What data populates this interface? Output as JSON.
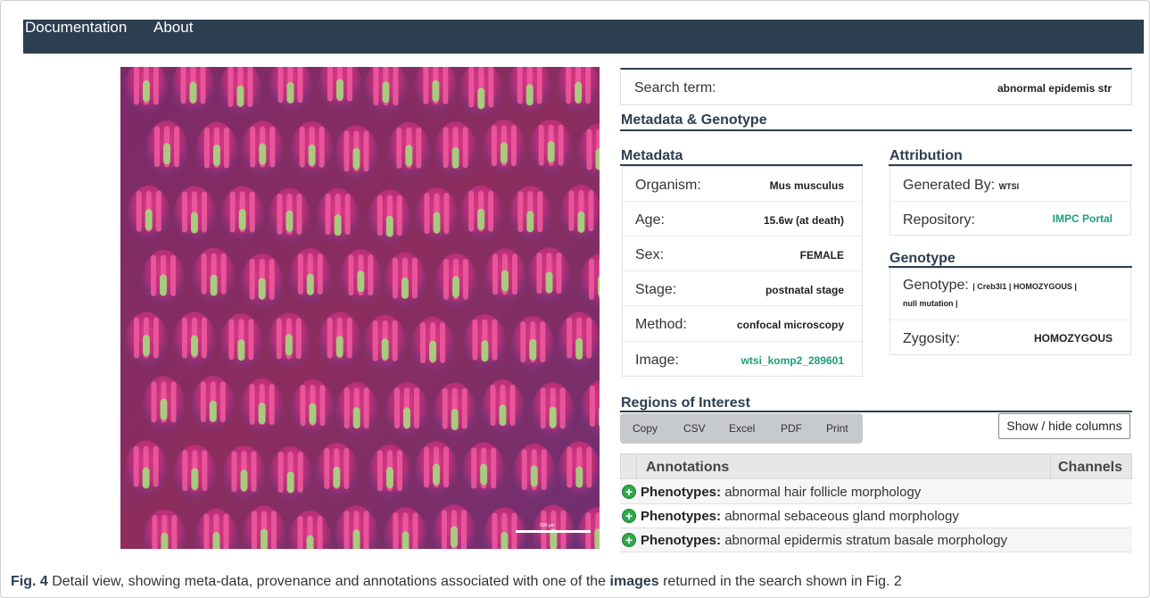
{
  "nav": {
    "documentation": "Documentation",
    "about": "About"
  },
  "image": {
    "scale_label": "500 µm"
  },
  "search": {
    "label": "Search term:",
    "value": "abnormal epidemis str"
  },
  "metadata_genotype_title": "Metadata & Genotype",
  "metadata": {
    "title": "Metadata",
    "rows": [
      {
        "label": "Organism:",
        "value": "Mus musculus"
      },
      {
        "label": "Age:",
        "value": "15.6w (at death)"
      },
      {
        "label": "Sex:",
        "value": "FEMALE"
      },
      {
        "label": "Stage:",
        "value": "postnatal stage"
      },
      {
        "label": "Method:",
        "value": "confocal microscopy"
      },
      {
        "label": "Image:",
        "value": "wtsi_komp2_289601"
      }
    ]
  },
  "attribution": {
    "title": "Attribution",
    "generated_by_label": "Generated By:",
    "generated_by_value": "WTSI",
    "repository_label": "Repository:",
    "repository_value": "IMPC Portal"
  },
  "genotype": {
    "title": "Genotype",
    "genotype_label": "Genotype:",
    "genotype_value_line1": "| Creb3l1 | HOMOZYGOUS |",
    "genotype_value_line2": "null mutation |",
    "zygosity_label": "Zygosity:",
    "zygosity_value": "HOMOZYGOUS"
  },
  "regions": {
    "title": "Regions of Interest",
    "buttons": [
      "Copy",
      "CSV",
      "Excel",
      "PDF",
      "Print"
    ],
    "show_hide": "Show / hide columns",
    "columns": {
      "annotations": "Annotations",
      "channels": "Channels"
    },
    "rows": [
      {
        "key": "Phenotypes:",
        "value": "abnormal hair follicle morphology"
      },
      {
        "key": "Phenotypes:",
        "value": "abnormal sebaceous gland morphology"
      },
      {
        "key": "Phenotypes:",
        "value": "abnormal epidermis stratum basale morphology"
      }
    ]
  },
  "caption": {
    "fig": "Fig. 4",
    "text1": " Detail view, showing meta-data, provenance and annotations associated with one of the ",
    "bold": "images",
    "text2": " returned in the search shown in Fig. 2"
  },
  "colors": {
    "navbar": "#2c3e50",
    "link": "#1a9e7e",
    "plus": "#2ea84a"
  }
}
